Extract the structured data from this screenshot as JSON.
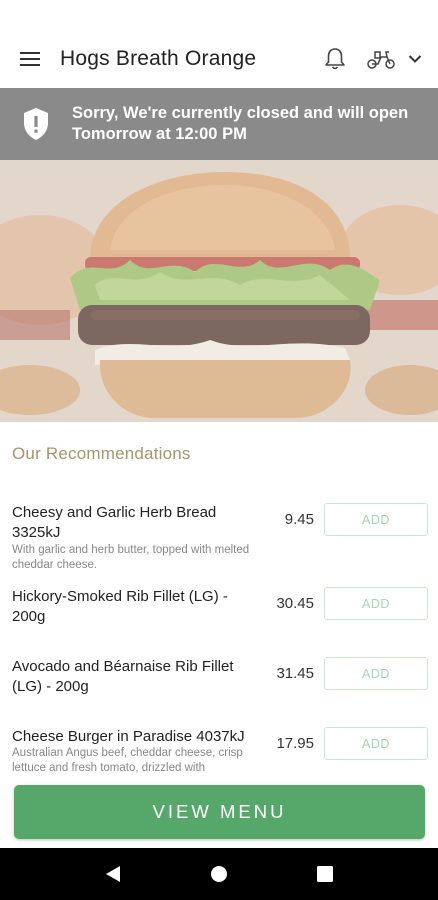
{
  "app": {
    "title": "Hogs Breath Orange"
  },
  "header": {
    "menu_icon": "hamburger-icon",
    "notification_icon": "bell-icon",
    "order_mode_icon": "scooter-icon",
    "dropdown_icon": "chevron-down-icon"
  },
  "notice": {
    "icon": "shield-alert-icon",
    "line1": "Sorry, We're currently closed and will open",
    "line2": "Tomorrow at 12:00 PM",
    "background": "#8a8a8a"
  },
  "recommendations": {
    "title": "Our Recommendations",
    "items": [
      {
        "name": "Cheesy and Garlic Herb Bread 3325kJ",
        "description": "With garlic and herb butter, topped with melted cheddar cheese.",
        "price": "9.45",
        "add_label": "ADD"
      },
      {
        "name": "Hickory-Smoked Rib Fillet (LG) - 200g",
        "description": "",
        "price": "30.45",
        "add_label": "ADD"
      },
      {
        "name": "Avocado and Béarnaise Rib Fillet (LG) - 200g",
        "description": "",
        "price": "31.45",
        "add_label": "ADD"
      },
      {
        "name": "Cheese Burger in Paradise 4037kJ",
        "description": "Australian Angus beef, cheddar cheese, crisp lettuce and fresh tomato, drizzled with",
        "price": "17.95",
        "add_label": "ADD"
      }
    ]
  },
  "cta": {
    "label": "VIEW MENU",
    "color": "#55a86a"
  },
  "system_nav": {
    "back_icon": "back-triangle-icon",
    "home_icon": "home-circle-icon",
    "recents_icon": "recents-square-icon"
  },
  "colors": {
    "accent_green": "#55a86a",
    "section_title": "#a7946b",
    "add_border": "#cfe6d6"
  }
}
